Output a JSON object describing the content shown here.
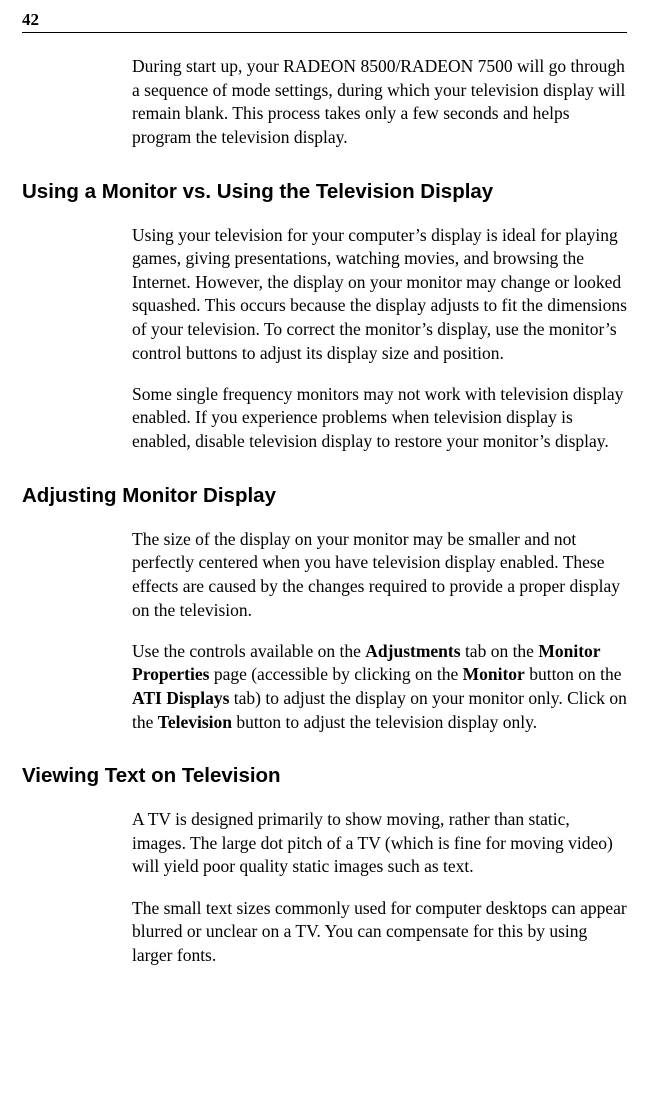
{
  "pageNumber": "42",
  "intro": "During start up, your RADEON 8500/RADEON 7500 will go through a sequence of mode settings, during which your television display will remain blank. This process takes only a few seconds and helps program the television display.",
  "section1": {
    "heading": "Using a Monitor vs. Using the Television Display",
    "p1": "Using your television for your computer’s display is ideal for playing games, giving presentations, watching movies, and browsing the Internet. However, the display on your monitor may change or looked squashed. This occurs because the display adjusts to fit the dimensions of your television. To correct the monitor’s display, use the monitor’s control buttons to adjust its display size and position.",
    "p2": "Some single frequency monitors may not work with television display enabled. If you experience problems when television display is enabled, disable television display to restore your monitor’s display."
  },
  "section2": {
    "heading": "Adjusting Monitor Display",
    "p1": "The size of the display on your monitor may be smaller and not perfectly centered when you have television display enabled. These effects are caused by the changes required to provide a proper display on the television.",
    "p2a": "Use the controls available on the ",
    "p2b": "Adjustments",
    "p2c": " tab on the ",
    "p2d": "Monitor Properties",
    "p2e": " page (accessible by clicking on the ",
    "p2f": "Monitor",
    "p2g": " button on the ",
    "p2h": "ATI Displays",
    "p2i": " tab) to adjust the display on your monitor only. Click on the ",
    "p2j": "Television",
    "p2k": " button to adjust the television display only."
  },
  "section3": {
    "heading": "Viewing Text on Television",
    "p1": "A TV is designed primarily to show moving, rather than static, images. The large dot pitch of a TV (which is fine for moving video) will yield poor quality static images such as text.",
    "p2": "The small text sizes commonly used for computer desktops can appear blurred or unclear on a TV. You can compensate for this by using larger fonts."
  }
}
